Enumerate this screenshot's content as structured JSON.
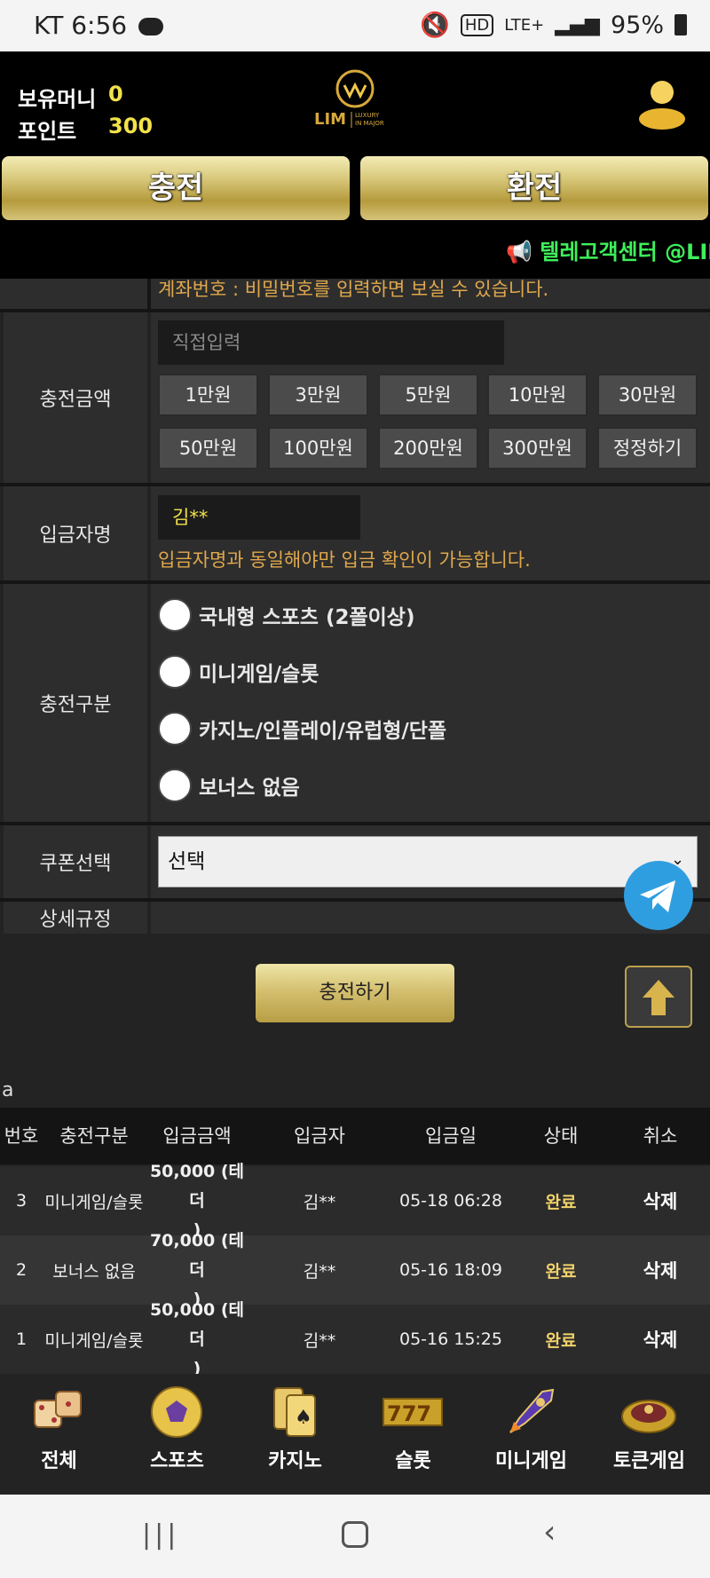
{
  "status_bar": {
    "carrier_time": "KT 6:56",
    "battery": "95%",
    "network": "LTE+"
  },
  "header": {
    "money_label": "보유머니",
    "money_value": "0",
    "point_label": "포인트",
    "point_value": "300",
    "logo_text": "LIM",
    "logo_tagline": "LUXURY IN MAJOR"
  },
  "tabs": {
    "charge": "충전",
    "exchange": "환전"
  },
  "marquee": "📢 텔레고객센터 @LIM",
  "account_note": "계좌번호 : 비밀번호를 입력하면 보실 수 있습니다.",
  "form": {
    "amount_label": "충전금액",
    "amount_placeholder": "직접입력",
    "amount_buttons": [
      "1만원",
      "3만원",
      "5만원",
      "10만원",
      "30만원",
      "50만원",
      "100만원",
      "200만원",
      "300만원",
      "정정하기"
    ],
    "depositor_label": "입금자명",
    "depositor_value": "김**",
    "depositor_warning": "입금자명과 동일해야만 입금 확인이 가능합니다.",
    "type_label": "충전구분",
    "type_options": [
      "국내형 스포츠 (2폴이상)",
      "미니게임/슬롯",
      "카지노/인플레이/유럽형/단폴",
      "보너스 없음"
    ],
    "coupon_label": "쿠폰선택",
    "coupon_value": "선택",
    "rules_label": "상세규정",
    "submit": "충전하기"
  },
  "table": {
    "caption": "a",
    "headers": [
      "번호",
      "충전구분",
      "입금금액",
      "입금자",
      "입금일",
      "상태",
      "취소"
    ],
    "rows": [
      {
        "no": "3",
        "type": "미니게임/슬롯",
        "amount1": "50,000 (테더",
        "amount2": ")",
        "name": "김**",
        "date": "05-18 06:28",
        "status": "완료",
        "cancel": "삭제"
      },
      {
        "no": "2",
        "type": "보너스 없음",
        "amount1": "70,000 (테더",
        "amount2": ")",
        "name": "김**",
        "date": "05-16 18:09",
        "status": "완료",
        "cancel": "삭제"
      },
      {
        "no": "1",
        "type": "미니게임/슬롯",
        "amount1": "50,000 (테더",
        "amount2": ")",
        "name": "김**",
        "date": "05-16 15:25",
        "status": "완료",
        "cancel": "삭제"
      }
    ]
  },
  "bottom_nav": [
    "전체",
    "스포츠",
    "카지노",
    "슬롯",
    "미니게임",
    "토큰게임"
  ],
  "colors": {
    "gold": "#d4c070",
    "green_marquee": "#3ef05a",
    "status_done": "#f2d36b",
    "warning": "#e0a84c"
  }
}
